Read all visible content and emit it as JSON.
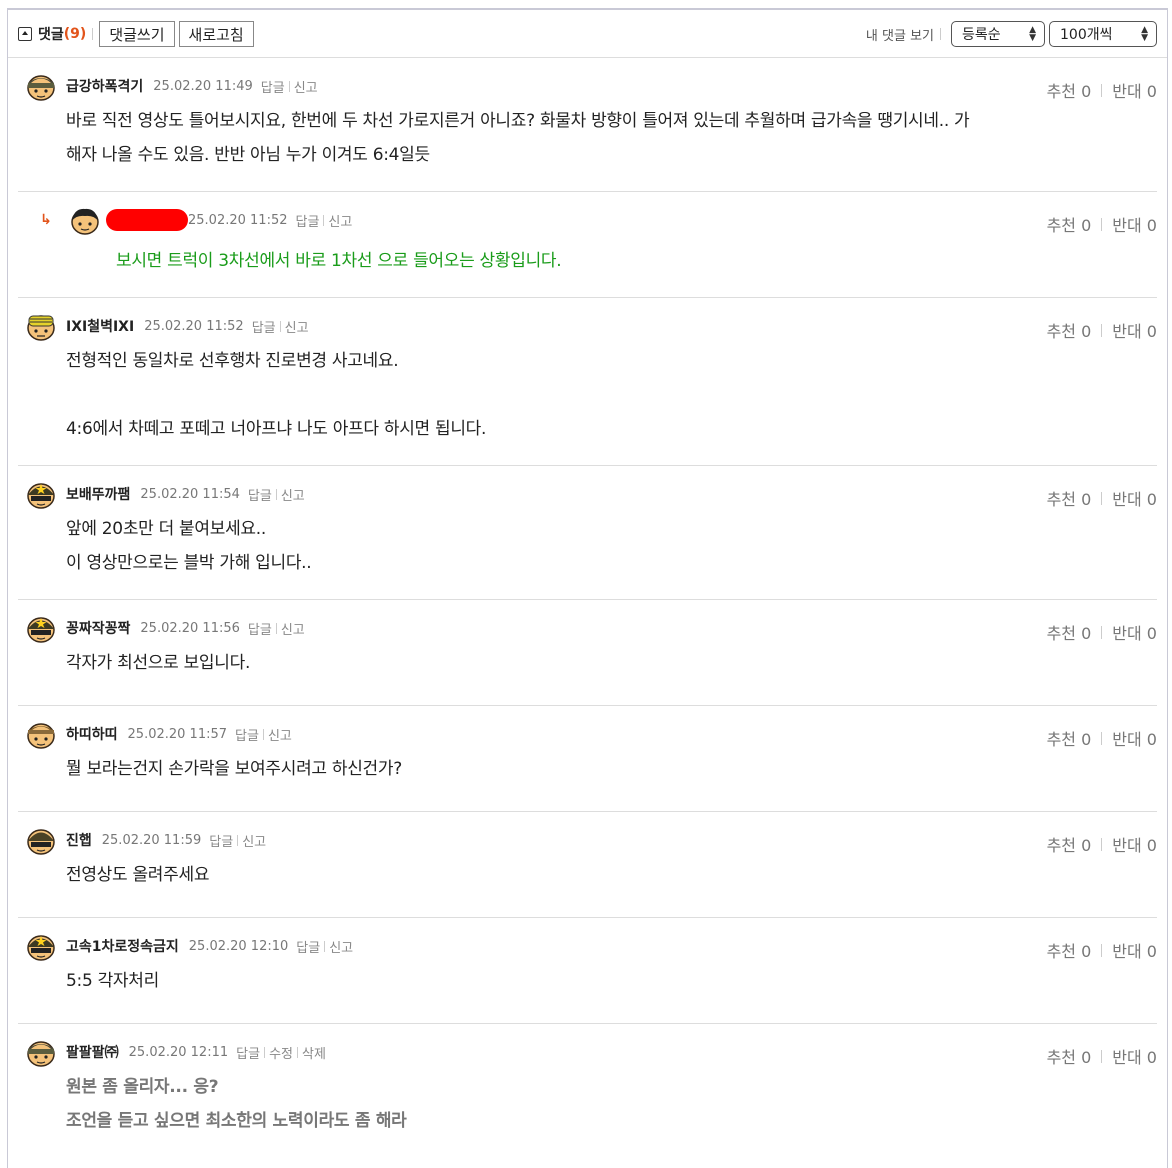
{
  "header": {
    "comments_label": "댓글",
    "comments_count": "(9)",
    "write_button": "댓글쓰기",
    "refresh_button": "새로고침",
    "my_comments_link": "내 댓글 보기",
    "sort_select": "등록순",
    "page_size_select": "100개씩"
  },
  "labels": {
    "reply": "답글",
    "report": "신고",
    "edit": "수정",
    "delete": "삭제",
    "recommend": "추천 0",
    "oppose": "반대 0",
    "reply_arrow": "↳"
  },
  "comments": [
    {
      "author": "급강하폭격기",
      "date": "25.02.20 11:49",
      "lines": [
        "바로 직전 영상도 틀어보시지요, 한번에 두 차선 가로지른거 아니죠? 화물차 방향이 틀어져 있는데 추월하며 급가속을 땡기시네.. 가",
        "해자 나올 수도 있음. 반반 아님 누가 이겨도 6:4일듯"
      ]
    },
    {
      "author": "",
      "date": "25.02.20 11:52",
      "lines": [
        "보시면 트럭이 3차선에서 바로 1차선 으로 들어오는 상황입니다."
      ]
    },
    {
      "author": "IXI철벽IXI",
      "date": "25.02.20 11:52",
      "lines": [
        "전형적인 동일차로 선후행차 진로변경 사고네요.",
        "",
        "4:6에서 차떼고 포떼고 너아프냐 나도 아프다 하시면 됩니다."
      ]
    },
    {
      "author": "보배뚜까팸",
      "date": "25.02.20 11:54",
      "lines": [
        "앞에 20초만 더 붙여보세요..",
        "이 영상만으로는 블박 가해 입니다.."
      ]
    },
    {
      "author": "꽁짜작꽁짝",
      "date": "25.02.20 11:56",
      "lines": [
        "각자가 최선으로 보입니다."
      ]
    },
    {
      "author": "하띠하띠",
      "date": "25.02.20 11:57",
      "lines": [
        "뭘 보라는건지 손가락을 보여주시려고 하신건가?"
      ]
    },
    {
      "author": "진햅",
      "date": "25.02.20 11:59",
      "lines": [
        "전영상도 올려주세요"
      ]
    },
    {
      "author": "고속1차로정속금지",
      "date": "25.02.20 12:10",
      "lines": [
        "5:5 각자처리"
      ]
    },
    {
      "author": "팔팔팔㈜",
      "date": "25.02.20 12:11",
      "lines": [
        "원본 좀 올리자... 응?",
        "조언을 듣고 싶으면 최소한의 노력이라도 좀 해라"
      ]
    }
  ]
}
